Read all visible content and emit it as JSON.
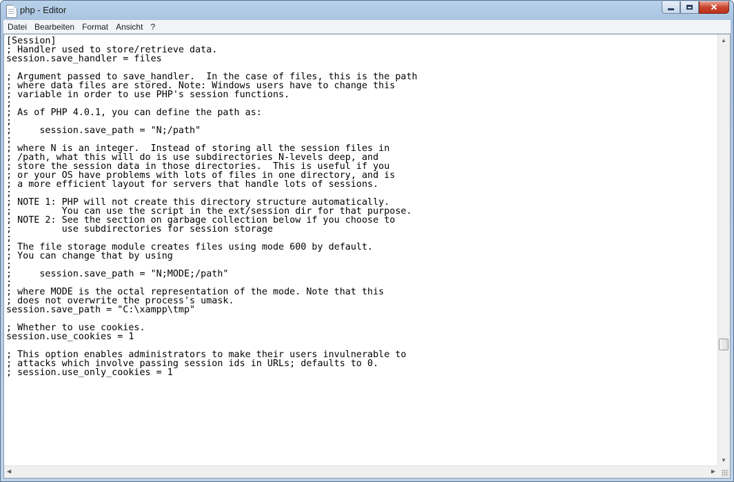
{
  "window": {
    "title": "php - Editor",
    "buttons": {
      "minimize": "–",
      "maximize": "□",
      "close": "✕"
    }
  },
  "menu": [
    "Datei",
    "Bearbeiten",
    "Format",
    "Ansicht",
    "?"
  ],
  "editor": {
    "content": "[Session]\n; Handler used to store/retrieve data.\nsession.save_handler = files\n\n; Argument passed to save_handler.  In the case of files, this is the path\n; where data files are stored. Note: Windows users have to change this\n; variable in order to use PHP's session functions.\n;\n; As of PHP 4.0.1, you can define the path as:\n;\n;     session.save_path = \"N;/path\"\n;\n; where N is an integer.  Instead of storing all the session files in\n; /path, what this will do is use subdirectories N-levels deep, and\n; store the session data in those directories.  This is useful if you\n; or your OS have problems with lots of files in one directory, and is\n; a more efficient layout for servers that handle lots of sessions.\n;\n; NOTE 1: PHP will not create this directory structure automatically.\n;         You can use the script in the ext/session dir for that purpose.\n; NOTE 2: See the section on garbage collection below if you choose to\n;         use subdirectories for session storage\n;\n; The file storage module creates files using mode 600 by default.\n; You can change that by using\n;\n;     session.save_path = \"N;MODE;/path\"\n;\n; where MODE is the octal representation of the mode. Note that this\n; does not overwrite the process's umask.\nsession.save_path = \"C:\\xampp\\tmp\"\n\n; Whether to use cookies.\nsession.use_cookies = 1\n\n; This option enables administrators to make their users invulnerable to\n; attacks which involve passing session ids in URLs; defaults to 0.\n; session.use_only_cookies = 1"
  },
  "scrollbar": {
    "up": "▲",
    "down": "▼",
    "left": "◀",
    "right": "▶"
  },
  "colors": {
    "titlebar": "#b9d1ea",
    "close_button": "#c9452b",
    "text": "#000000"
  }
}
